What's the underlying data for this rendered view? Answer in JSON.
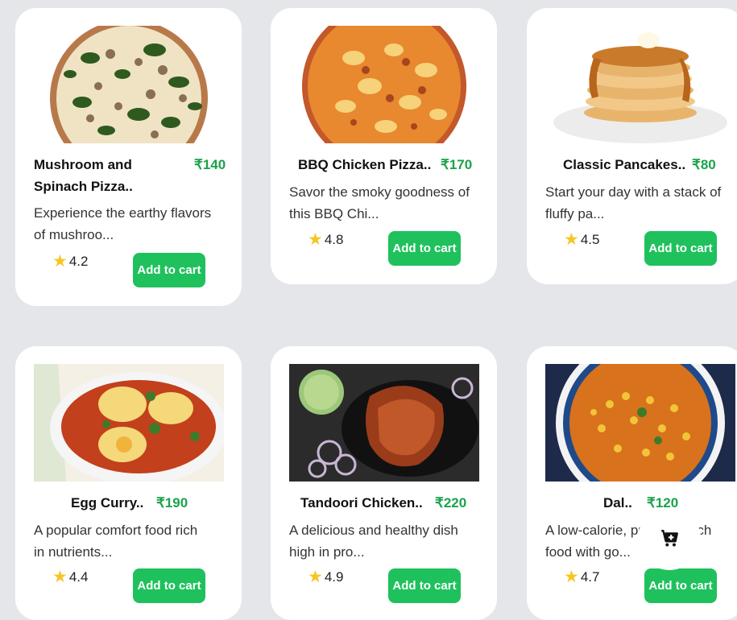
{
  "products": [
    {
      "name_line1": "Mushroom and",
      "name_line2": "Spinach Pizza..",
      "price": "₹140",
      "desc_line1": "Experience the earthy flavors",
      "desc_line2": "of mushroo...",
      "rating": "4.2",
      "button": "Add to cart",
      "image_icon": "mushroom-spinach-pizza-photo"
    },
    {
      "name": "BBQ Chicken Pizza..",
      "price": "₹170",
      "desc_line1": "Savor the smoky goodness of",
      "desc_line2": "this BBQ Chi...",
      "rating": "4.8",
      "button": "Add to cart",
      "image_icon": "bbq-chicken-pizza-photo"
    },
    {
      "name": "Classic Pancakes..",
      "price": "₹80",
      "desc_line1": "Start your day with a stack of",
      "desc_line2": "fluffy pa...",
      "rating": "4.5",
      "button": "Add to cart",
      "image_icon": "pancakes-photo"
    },
    {
      "name": "Egg Curry..",
      "price": "₹190",
      "desc_line1": "A popular comfort food rich",
      "desc_line2": "in nutrients...",
      "rating": "4.4",
      "button": "Add to cart",
      "image_icon": "egg-curry-photo"
    },
    {
      "name": "Tandoori Chicken..",
      "price": "₹220",
      "desc_line1": "A delicious and healthy dish",
      "desc_line2": "high in pro...",
      "rating": "4.9",
      "button": "Add to cart",
      "image_icon": "tandoori-chicken-photo"
    },
    {
      "name": "Dal..",
      "price": "₹120",
      "desc_line1": "A low-calorie, pr",
      "desc_line1_end": "rich",
      "desc_line2": "food with go...",
      "rating": "4.7",
      "button": "Add to cart",
      "image_icon": "dal-photo"
    }
  ],
  "floating_cart": {
    "icon": "cart-plus-icon"
  },
  "colors": {
    "price": "#1aa34a",
    "button": "#1fc15c",
    "star": "#f7c623",
    "background": "#e4e6ea"
  }
}
